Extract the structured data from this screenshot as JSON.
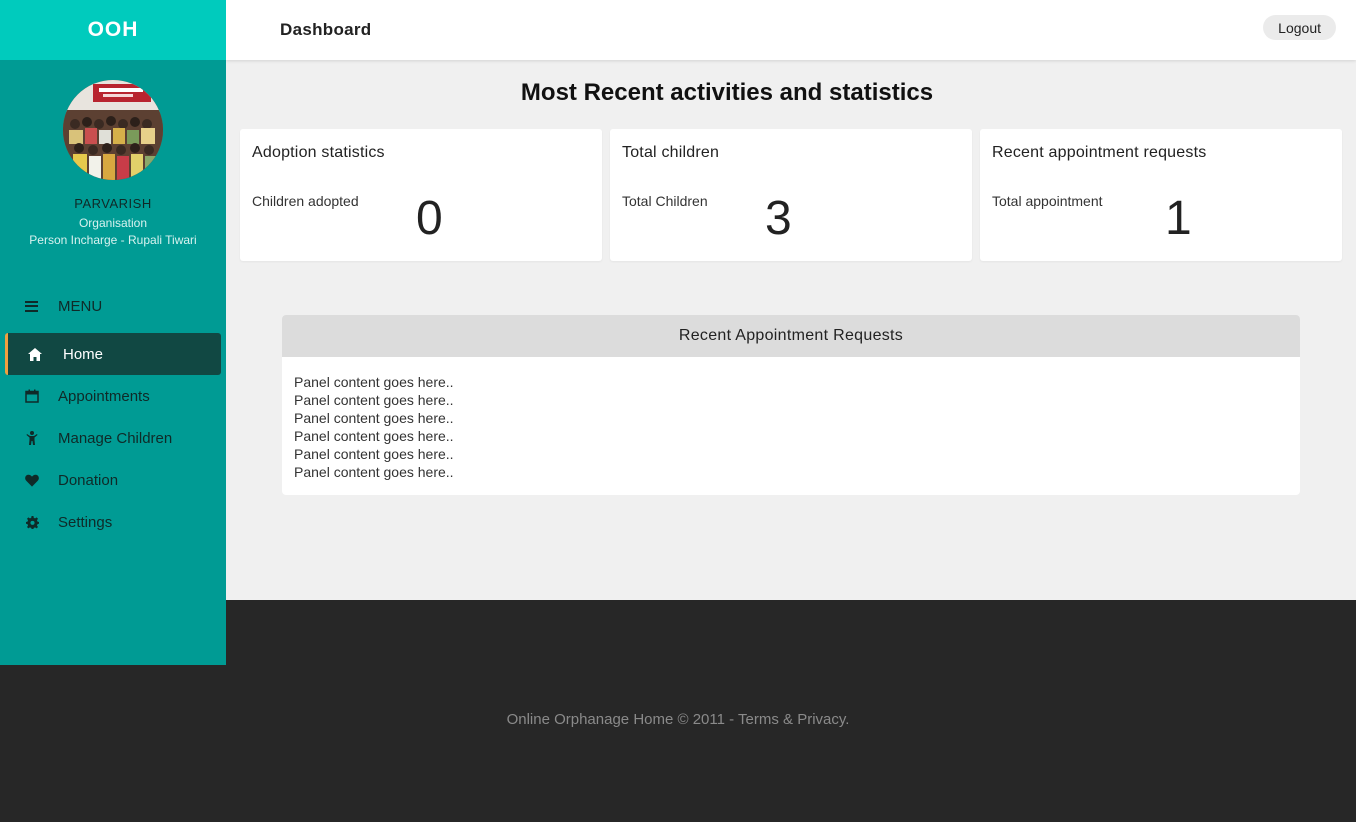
{
  "brand": "OOH",
  "profile": {
    "name": "PARVARISH",
    "type": "Organisation",
    "person": "Person Incharge - Rupali Tiwari"
  },
  "menu": {
    "label": "MENU",
    "items": [
      {
        "label": "Home",
        "icon": "home-icon"
      },
      {
        "label": "Appointments",
        "icon": "calendar-icon"
      },
      {
        "label": "Manage Children",
        "icon": "child-icon"
      },
      {
        "label": "Donation",
        "icon": "heart-icon"
      },
      {
        "label": "Settings",
        "icon": "gear-icon"
      }
    ]
  },
  "header": {
    "title": "Dashboard",
    "logout_label": "Logout"
  },
  "main": {
    "heading": "Most Recent activities and statistics",
    "cards": [
      {
        "title": "Adoption statistics",
        "label": "Children adopted",
        "value": "0"
      },
      {
        "title": "Total children",
        "label": "Total Children",
        "value": "3"
      },
      {
        "title": "Recent appointment requests",
        "label": "Total appointment",
        "value": "1"
      }
    ],
    "panel": {
      "title": "Recent Appointment Requests",
      "lines": [
        "Panel content goes here..",
        "Panel content goes here..",
        "Panel content goes here..",
        "Panel content goes here..",
        "Panel content goes here..",
        "Panel content goes here.."
      ]
    }
  },
  "footer": {
    "text": "Online Orphanage Home © 2011 - Terms & Privacy."
  },
  "colors": {
    "brand_bar": "#00cbbd",
    "sidebar": "#009b94",
    "active_item": "#114843",
    "active_accent": "#f0a040",
    "footer": "#272727"
  }
}
